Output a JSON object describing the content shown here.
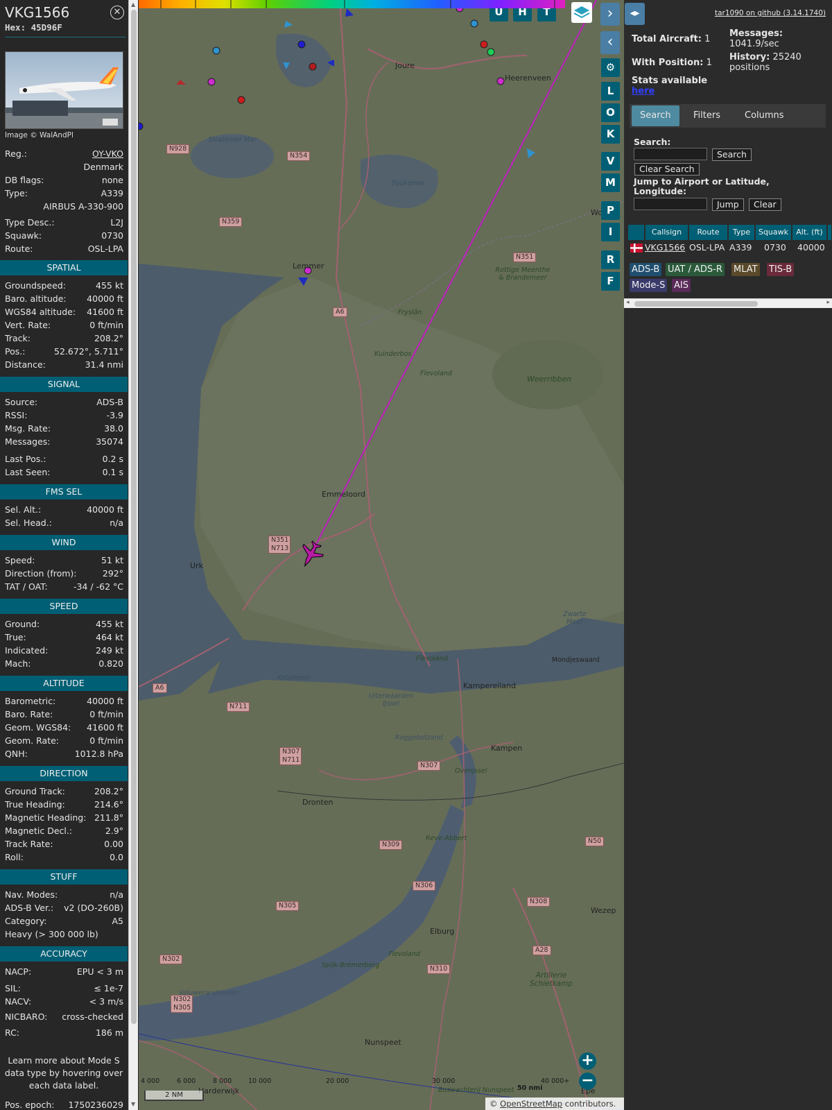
{
  "info": {
    "callsign": "VKG1566",
    "hex": "Hex: 45D96F",
    "photo_credit": "Image © WalAndPl",
    "reg_label": "Reg.:",
    "reg": "OY-VKO",
    "country": "Denmark",
    "dbflags_label": "DB flags:",
    "dbflags": "none",
    "type_label": "Type:",
    "type": "A339",
    "type_full": "AIRBUS A-330-900",
    "typedesc_label": "Type Desc.:",
    "typedesc": "L2J",
    "squawk_label": "Squawk:",
    "squawk": "0730",
    "route_label": "Route:",
    "route": "OSL-LPA",
    "sections": {
      "spatial": "SPATIAL",
      "signal": "SIGNAL",
      "fms": "FMS SEL",
      "wind": "WIND",
      "speed": "SPEED",
      "altitude": "ALTITUDE",
      "direction": "DIRECTION",
      "stuff": "STUFF",
      "accuracy": "ACCURACY"
    },
    "spatial": [
      {
        "k": "Groundspeed:",
        "v": "455 kt"
      },
      {
        "k": "Baro. altitude:",
        "v": "40000 ft"
      },
      {
        "k": "WGS84 altitude:",
        "v": "41600 ft"
      },
      {
        "k": "Vert. Rate:",
        "v": "0 ft/min"
      },
      {
        "k": "Track:",
        "v": "208.2°"
      },
      {
        "k": "Pos.:",
        "v": "52.672°, 5.711°"
      },
      {
        "k": "Distance:",
        "v": "31.4 nmi"
      }
    ],
    "signal": [
      {
        "k": "Source:",
        "v": "ADS-B"
      },
      {
        "k": "RSSI:",
        "v": "-3.9"
      },
      {
        "k": "Msg. Rate:",
        "v": "38.0"
      },
      {
        "k": "Messages:",
        "v": "35074"
      },
      {
        "k": "Last Pos.:",
        "v": "0.2 s"
      },
      {
        "k": "Last Seen:",
        "v": "0.1 s"
      }
    ],
    "fms": [
      {
        "k": "Sel. Alt.:",
        "v": "40000 ft"
      },
      {
        "k": "Sel. Head.:",
        "v": "n/a"
      }
    ],
    "wind": [
      {
        "k": "Speed:",
        "v": "51 kt"
      },
      {
        "k": "Direction (from):",
        "v": "292°"
      },
      {
        "k": "TAT / OAT:",
        "v": "-34 / -62 °C"
      }
    ],
    "speed": [
      {
        "k": "Ground:",
        "v": "455 kt"
      },
      {
        "k": "True:",
        "v": "464 kt"
      },
      {
        "k": "Indicated:",
        "v": "249 kt"
      },
      {
        "k": "Mach:",
        "v": "0.820"
      }
    ],
    "altitude": [
      {
        "k": "Barometric:",
        "v": "40000 ft"
      },
      {
        "k": "Baro. Rate:",
        "v": "0 ft/min"
      },
      {
        "k": "Geom. WGS84:",
        "v": "41600 ft"
      },
      {
        "k": "Geom. Rate:",
        "v": "0 ft/min"
      },
      {
        "k": "QNH:",
        "v": "1012.8 hPa"
      }
    ],
    "direction": [
      {
        "k": "Ground Track:",
        "v": "208.2°"
      },
      {
        "k": "True Heading:",
        "v": "214.6°"
      },
      {
        "k": "Magnetic Heading:",
        "v": "211.8°"
      },
      {
        "k": "Magnetic Decl.:",
        "v": "2.9°"
      },
      {
        "k": "Track Rate:",
        "v": "0.00"
      },
      {
        "k": "Roll:",
        "v": "0.0"
      }
    ],
    "stuff": [
      {
        "k": "Nav. Modes:",
        "v": "n/a"
      },
      {
        "k": "ADS-B Ver.:",
        "v": "v2 (DO-260B)"
      },
      {
        "k": "Category:",
        "v": "A5"
      }
    ],
    "stuff_extra": "Heavy (> 300 000 lb)",
    "accuracy": [
      {
        "k": "NACP:",
        "v": "EPU < 3 m"
      },
      {
        "k": "SIL:",
        "v": "≤ 1e-7"
      },
      {
        "k": "NACV:",
        "v": "< 3 m/s"
      },
      {
        "k": "NICBARO:",
        "v": "cross-checked"
      },
      {
        "k": "RC:",
        "v": "186 m"
      }
    ],
    "note": "Learn more about Mode S data type by hovering over each data label.",
    "epoch_label": "Pos. epoch:",
    "epoch": "1750236029"
  },
  "map": {
    "buttons_top": [
      "U",
      "H",
      "T"
    ],
    "buttons_side": [
      "L",
      "O",
      "K",
      "V",
      "M",
      "P",
      "I",
      "R",
      "F"
    ],
    "scale": "2 NM",
    "attribution_prefix": "© ",
    "attribution_link": "OpenStreetMap",
    "attribution_suffix": " contributors.",
    "altitude_legend": [
      "4 000",
      "6 000",
      "8 000",
      "10 000",
      "20 000",
      "30 000",
      "40 000+"
    ],
    "range_label": "50 nmi",
    "towns": [
      "Joure",
      "Heerenveen",
      "Lemmer",
      "Emmeloord",
      "Urk",
      "Kampen",
      "Dronten",
      "Elburg",
      "Nunspeet",
      "Harderwijk",
      "Wezep",
      "Epe",
      "Kampereiland",
      "Mondjeswaard",
      "Wo"
    ],
    "waters": [
      "Sloatemer Mar",
      "Tsjûkemar",
      "Ketelmeer",
      "Veluwerandmeren",
      "Uiterwaarden IJssel",
      "Zwarte Meer",
      "Roggebotzand"
    ],
    "nature": [
      "Rottige Meenthe & Brandemeer",
      "Kuinderbos",
      "Weerribben",
      "Reve-Abbert",
      "Artillerie Schietkamp",
      "Spijk-Bremerberg",
      "Boswachterij Nunspeet",
      "Flevoland",
      "Fryslân",
      "Flevoland",
      "Flevoland",
      "Overijssel"
    ],
    "roads": [
      "N928",
      "N354",
      "N359",
      "N351",
      "A6",
      "N351 N713",
      "N711",
      "A6",
      "N307 N711",
      "N307",
      "N309",
      "N306",
      "N305",
      "N302",
      "N302 N305",
      "N310",
      "A28",
      "N308",
      "N50"
    ]
  },
  "sidebar": {
    "github": "tar1090 on github (3.14.1740)",
    "total_label": "Total Aircraft:",
    "total": "1",
    "withpos_label": "With Position:",
    "withpos": "1",
    "messages_label": "Messages:",
    "messages": "1041.9/sec",
    "history_label": "History:",
    "history": "25240 positions",
    "stats_text": "Stats available",
    "stats_link": "here",
    "tabs": [
      "Search",
      "Filters",
      "Columns"
    ],
    "search_label": "Search:",
    "search_btn": "Search",
    "clear_search_btn": "Clear Search",
    "jump_label": "Jump to Airport or Latitude, Longitude:",
    "jump_btn": "Jump",
    "clear_btn": "Clear",
    "columns": [
      "Callsign",
      "Route",
      "Type",
      "Squawk",
      "Alt. (ft)"
    ],
    "row": {
      "callsign": "VKG1566",
      "route": "OSL-LPA",
      "type": "A339",
      "squawk": "0730",
      "alt": "40000"
    },
    "chips": [
      {
        "label": "ADS-B",
        "color": "#1f4f6f"
      },
      {
        "label": "UAT / ADS-R",
        "color": "#2a5a3a"
      },
      {
        "label": "MLAT",
        "color": "#5a4a2a"
      },
      {
        "label": "TIS-B",
        "color": "#6a2a3a"
      },
      {
        "label": "Mode-S",
        "color": "#3a3a6a"
      },
      {
        "label": "AIS",
        "color": "#5a2a5a"
      }
    ]
  }
}
